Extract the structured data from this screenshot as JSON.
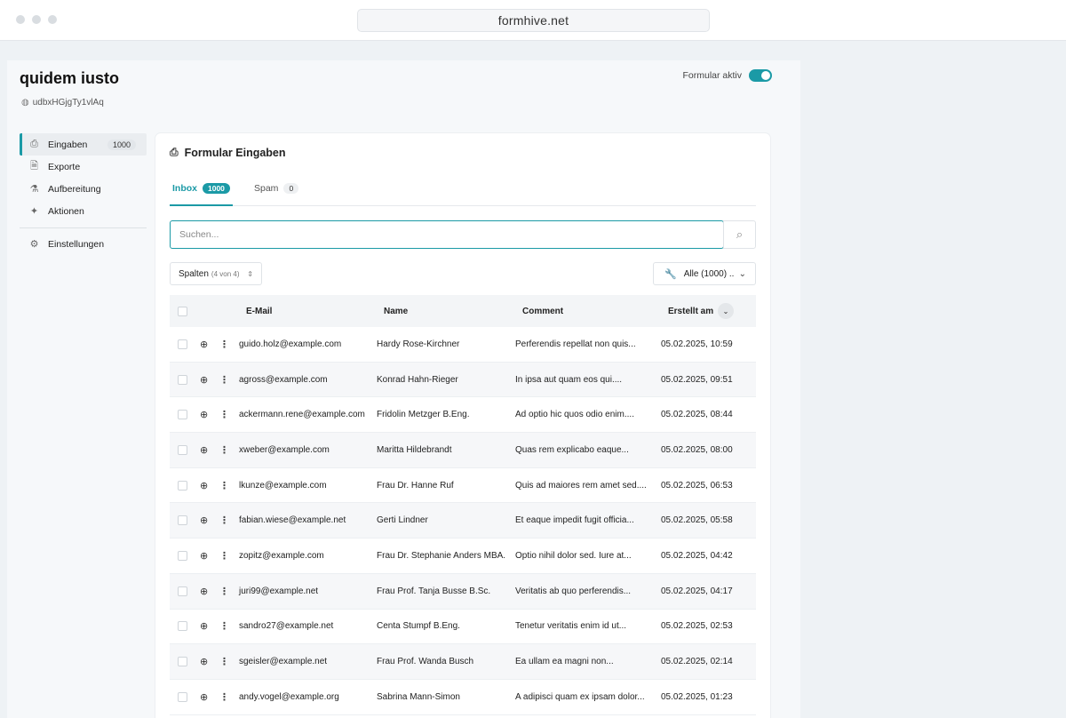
{
  "browser": {
    "url": "formhive.net"
  },
  "form": {
    "title": "quidem iusto",
    "id": "udbxHGjgTy1vlAq",
    "active_label": "Formular aktiv",
    "active": true
  },
  "sidebar": {
    "items": [
      {
        "label": "Eingaben",
        "badge": "1000",
        "icon": "inbox-icon",
        "active": true
      },
      {
        "label": "Exporte",
        "icon": "file-export-icon"
      },
      {
        "label": "Aufbereitung",
        "icon": "flask-icon"
      },
      {
        "label": "Aktionen",
        "icon": "sparkles-icon"
      }
    ],
    "settings_label": "Einstellungen"
  },
  "main": {
    "title": "Formular Eingaben",
    "tabs": [
      {
        "label": "Inbox",
        "count": "1000",
        "active": true
      },
      {
        "label": "Spam",
        "count": "0"
      }
    ],
    "search": {
      "placeholder": "Suchen...",
      "value": ""
    },
    "columns_button": {
      "label": "Spalten",
      "sub": "(4 von 4)"
    },
    "filter_button": {
      "label": "Alle (1000) .."
    },
    "accent_color": "#1b9aa6"
  },
  "table": {
    "headers": {
      "email": "E-Mail",
      "name": "Name",
      "comment": "Comment",
      "date": "Erstellt am"
    },
    "rows": [
      {
        "email": "guido.holz@example.com",
        "name": "Hardy Rose-Kirchner",
        "comment": "Perferendis repellat non quis...",
        "date": "05.02.2025, 10:59"
      },
      {
        "email": "agross@example.com",
        "name": "Konrad Hahn-Rieger",
        "comment": "In ipsa aut quam eos qui....",
        "date": "05.02.2025, 09:51"
      },
      {
        "email": "ackermann.rene@example.com",
        "name": "Fridolin Metzger B.Eng.",
        "comment": "Ad optio hic quos odio enim....",
        "date": "05.02.2025, 08:44"
      },
      {
        "email": "xweber@example.com",
        "name": "Maritta Hildebrandt",
        "comment": "Quas rem explicabo eaque...",
        "date": "05.02.2025, 08:00"
      },
      {
        "email": "lkunze@example.com",
        "name": "Frau Dr. Hanne Ruf",
        "comment": "Quis ad maiores rem amet sed....",
        "date": "05.02.2025, 06:53"
      },
      {
        "email": "fabian.wiese@example.net",
        "name": "Gerti Lindner",
        "comment": "Et eaque impedit fugit officia...",
        "date": "05.02.2025, 05:58"
      },
      {
        "email": "zopitz@example.com",
        "name": "Frau Dr. Stephanie Anders MBA.",
        "comment": "Optio nihil dolor sed. Iure at...",
        "date": "05.02.2025, 04:42"
      },
      {
        "email": "juri99@example.net",
        "name": "Frau Prof. Tanja Busse B.Sc.",
        "comment": "Veritatis ab quo perferendis...",
        "date": "05.02.2025, 04:17"
      },
      {
        "email": "sandro27@example.net",
        "name": "Centa Stumpf B.Eng.",
        "comment": "Tenetur veritatis enim id ut...",
        "date": "05.02.2025, 02:53"
      },
      {
        "email": "sgeisler@example.net",
        "name": "Frau Prof. Wanda Busch",
        "comment": "Ea ullam ea magni non...",
        "date": "05.02.2025, 02:14"
      },
      {
        "email": "andy.vogel@example.org",
        "name": "Sabrina Mann-Simon",
        "comment": "A adipisci quam ex ipsam dolor...",
        "date": "05.02.2025, 01:23"
      }
    ]
  }
}
